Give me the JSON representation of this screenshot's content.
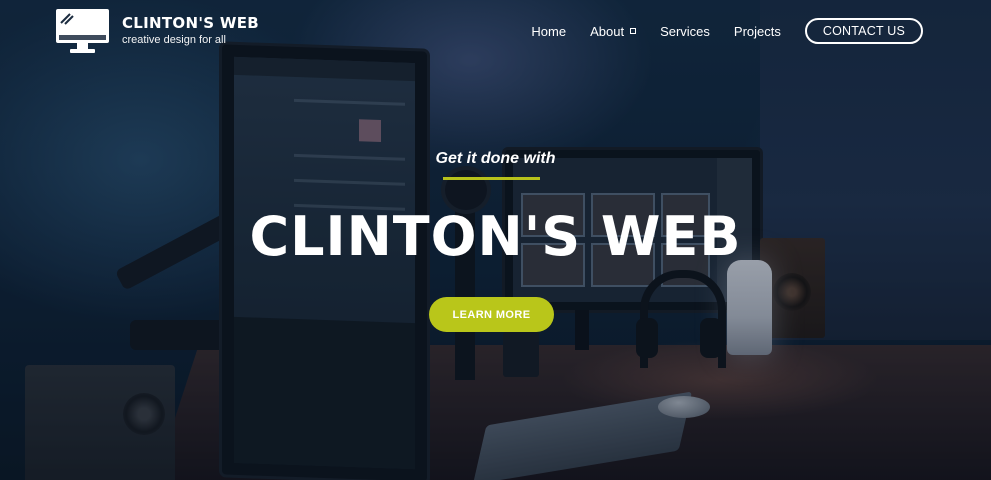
{
  "header": {
    "brand_name": "CLINTON'S WEB",
    "tagline": "creative design for all",
    "logo_icon": "monitor-icon",
    "nav": [
      {
        "label": "Home"
      },
      {
        "label": "About",
        "has_dropdown": true,
        "icon": "dropdown-icon"
      },
      {
        "label": "Services"
      },
      {
        "label": "Projects"
      }
    ],
    "contact_label": "CONTACT US"
  },
  "hero": {
    "kicker": "Get it done with",
    "title": "CLINTON'S WEB",
    "cta_label": "LEARN MORE"
  },
  "colors": {
    "accent": "#b9c61a",
    "text": "#ffffff",
    "background": "#0f2237"
  }
}
